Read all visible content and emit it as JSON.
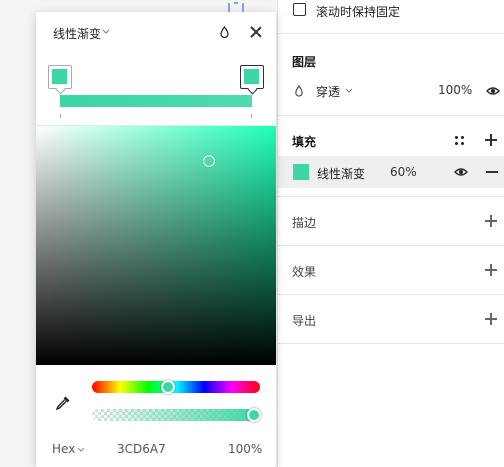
{
  "colors": {
    "fill": "#3CD6A7",
    "panel_border": "#e8e8e8",
    "selected_row": "#efefef"
  },
  "panel": {
    "fix_scroll_label": "滚动时保持固定",
    "layer": {
      "title": "图层",
      "blend_mode": "穿透",
      "opacity": "100%"
    },
    "fill": {
      "title": "填充",
      "type": "线性渐变",
      "opacity": "60%"
    },
    "stroke": {
      "title": "描边"
    },
    "effects": {
      "title": "效果"
    },
    "export": {
      "title": "导出"
    }
  },
  "picker": {
    "fill_type": "线性渐变",
    "color_mode": "Hex",
    "hex_value": "3CD6A7",
    "alpha": "100%",
    "hue_position": 0.44,
    "alpha_position": 1.0,
    "gradient_stops": [
      {
        "color": "#3CD6A7",
        "position": 0.0
      },
      {
        "color": "#3CD6A7",
        "position": 1.0
      }
    ]
  },
  "icons": [
    "chevron-down-icon",
    "drop-icon",
    "close-icon",
    "eyedropper-icon",
    "eye-icon",
    "dots-grid-icon",
    "plus-icon",
    "minus-icon",
    "component-icon"
  ]
}
